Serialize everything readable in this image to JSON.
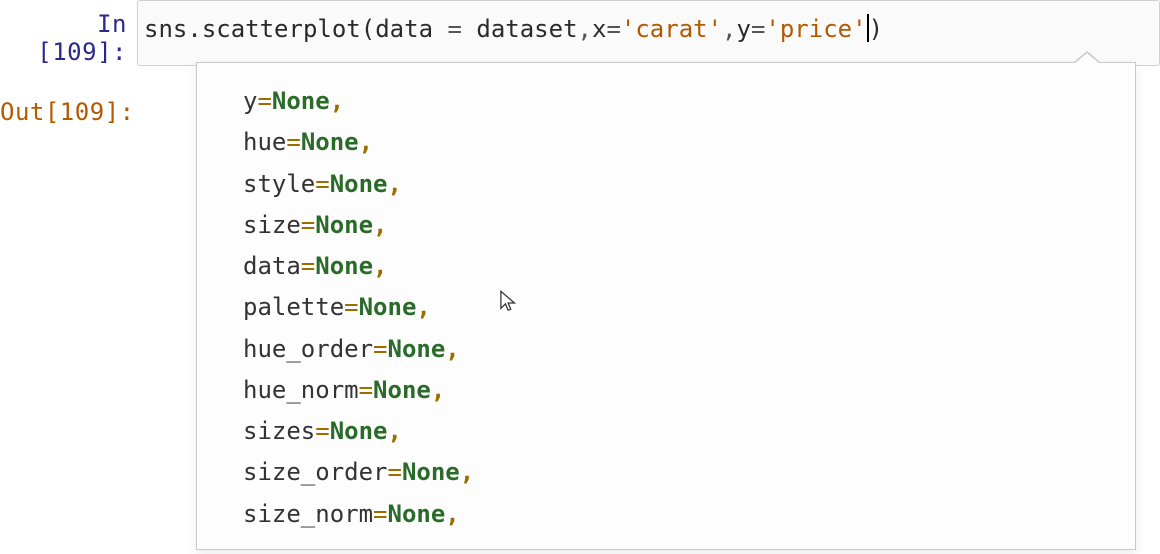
{
  "input": {
    "prompt_prefix": "In [",
    "prompt_num": "109",
    "prompt_suffix": "]:",
    "code": {
      "t1": "sns",
      "t2": ".",
      "t3": "scatterplot",
      "t4": "(",
      "t5": "data",
      "t6": " = ",
      "t7": "dataset",
      "t8": ",",
      "t9": "x",
      "t10": "=",
      "t11": "'carat'",
      "t12": ",",
      "t13": "y",
      "t14": "=",
      "t15": "'price'",
      "t16": ")"
    }
  },
  "output": {
    "prompt_prefix": "Out[",
    "prompt_num": "109",
    "prompt_suffix": "]:"
  },
  "tooltip": {
    "params": [
      {
        "name": "y",
        "value": "None"
      },
      {
        "name": "hue",
        "value": "None"
      },
      {
        "name": "style",
        "value": "None"
      },
      {
        "name": "size",
        "value": "None"
      },
      {
        "name": "data",
        "value": "None"
      },
      {
        "name": "palette",
        "value": "None"
      },
      {
        "name": "hue_order",
        "value": "None"
      },
      {
        "name": "hue_norm",
        "value": "None"
      },
      {
        "name": "sizes",
        "value": "None"
      },
      {
        "name": "size_order",
        "value": "None"
      },
      {
        "name": "size_norm",
        "value": "None"
      }
    ],
    "eq": "=",
    "comma": ","
  }
}
